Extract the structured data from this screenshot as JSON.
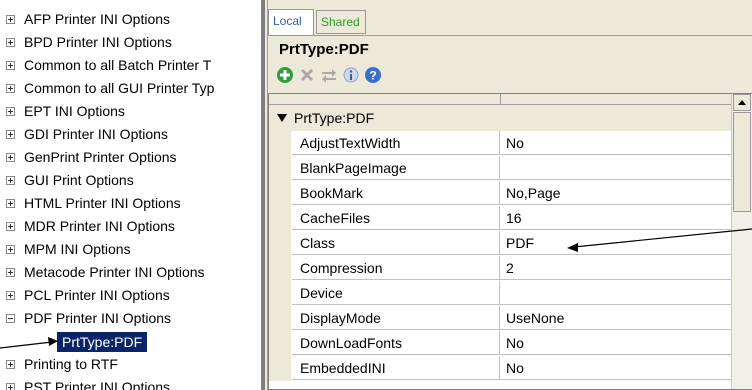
{
  "tree": {
    "items": [
      {
        "label": "AFP Printer INI Options",
        "state": "plus"
      },
      {
        "label": "BPD Printer INI Options",
        "state": "plus"
      },
      {
        "label": "Common to all Batch Printer T",
        "state": "plus"
      },
      {
        "label": "Common to all GUI Printer Typ",
        "state": "plus"
      },
      {
        "label": "EPT INI Options",
        "state": "plus"
      },
      {
        "label": "GDI Printer INI Options",
        "state": "plus"
      },
      {
        "label": "GenPrint Printer Options",
        "state": "plus"
      },
      {
        "label": "GUI Print Options",
        "state": "plus"
      },
      {
        "label": "HTML Printer INI Options",
        "state": "plus"
      },
      {
        "label": "MDR Printer INI Options",
        "state": "plus"
      },
      {
        "label": "MPM INI Options",
        "state": "plus"
      },
      {
        "label": "Metacode Printer INI Options",
        "state": "plus"
      },
      {
        "label": "PCL Printer INI Options",
        "state": "plus"
      },
      {
        "label": "PDF Printer INI Options",
        "state": "minus"
      },
      {
        "label": "Printing to RTF",
        "state": "plus"
      },
      {
        "label": "PST Printer INI Options",
        "state": "plus"
      }
    ],
    "selected_child": "PrtType:PDF"
  },
  "tabs": {
    "local": "Local",
    "shared": "Shared"
  },
  "panel": {
    "title": "PrtType:PDF"
  },
  "toolbar": {
    "icons": [
      "add-icon",
      "delete-icon",
      "move-icon",
      "info-icon",
      "help-icon"
    ]
  },
  "grid": {
    "group": "PrtType:PDF",
    "rows": [
      {
        "name": "AdjustTextWidth",
        "value": "No"
      },
      {
        "name": "BlankPageImage",
        "value": ""
      },
      {
        "name": "BookMark",
        "value": "No,Page"
      },
      {
        "name": "CacheFiles",
        "value": "16"
      },
      {
        "name": "Class",
        "value": "PDF"
      },
      {
        "name": "Compression",
        "value": "2"
      },
      {
        "name": "Device",
        "value": ""
      },
      {
        "name": "DisplayMode",
        "value": "UseNone"
      },
      {
        "name": "DownLoadFonts",
        "value": "No"
      },
      {
        "name": "EmbeddedINI",
        "value": "No"
      }
    ]
  },
  "colors": {
    "selection": "#0a246a",
    "panel": "#ece9d8",
    "tab_local": "#2b5fa6",
    "tab_shared": "#2ba02b"
  }
}
